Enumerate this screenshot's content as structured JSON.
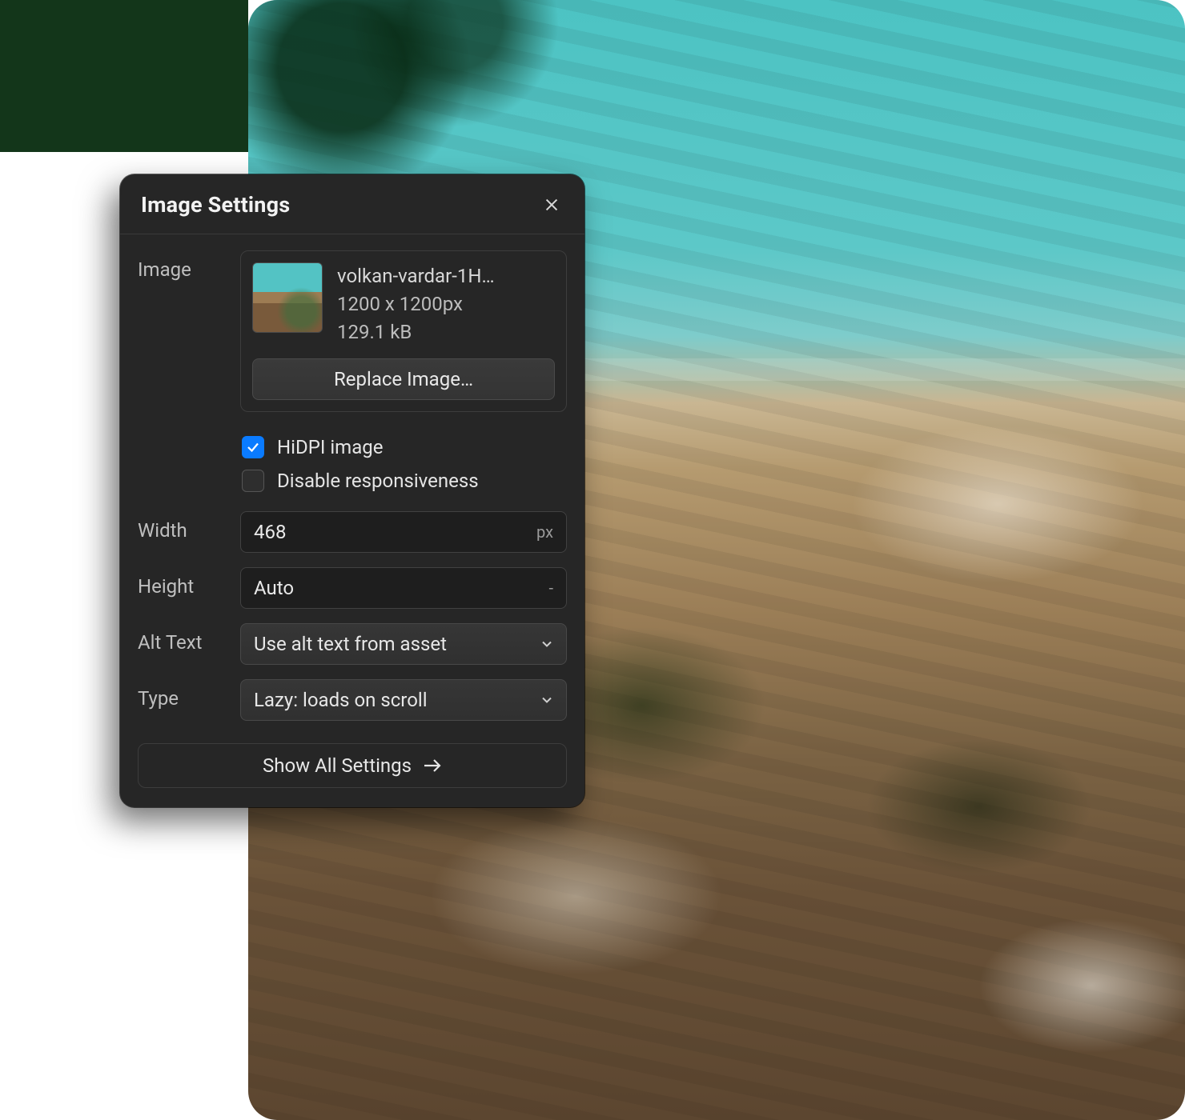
{
  "panel": {
    "title": "Image Settings",
    "image": {
      "label": "Image",
      "filename": "volkan-vardar-1H…",
      "dimensions": "1200 x 1200px",
      "filesize": "129.1 kB",
      "replace_label": "Replace Image…"
    },
    "options": {
      "hidpi": {
        "label": "HiDPI image",
        "checked": true
      },
      "disable_responsive": {
        "label": "Disable responsiveness",
        "checked": false
      }
    },
    "width": {
      "label": "Width",
      "value": "468",
      "unit": "px"
    },
    "height": {
      "label": "Height",
      "value": "Auto",
      "unit": "-"
    },
    "alt": {
      "label": "Alt Text",
      "value": "Use alt text from asset"
    },
    "type": {
      "label": "Type",
      "value": "Lazy: loads on scroll"
    },
    "show_all": "Show All Settings"
  }
}
